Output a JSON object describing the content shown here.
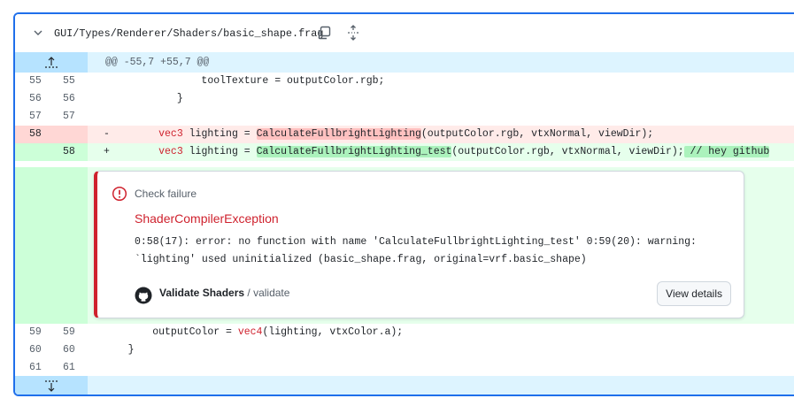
{
  "file": {
    "path": "GUI/Types/Renderer/Shaders/basic_shape.frag",
    "copy_icon": "copy-icon",
    "expand_icon": "unfold-icon"
  },
  "hunks": {
    "top": "@@ -55,7 +55,7 @@"
  },
  "lines": [
    {
      "old": "55",
      "new": "55",
      "code": "                toolTexture = outputColor.rgb;"
    },
    {
      "old": "56",
      "new": "56",
      "code": "            }"
    },
    {
      "old": "57",
      "new": "57",
      "code": ""
    }
  ],
  "deleted": {
    "old": "58",
    "sign": "-",
    "indent": "        ",
    "kw": "vec3",
    "before": " lighting = ",
    "hl": "CalculateFullbrightLighting",
    "after": "(outputColor.rgb, vtxNormal, viewDir);"
  },
  "added": {
    "new": "58",
    "sign": "+",
    "indent": "        ",
    "kw": "vec3",
    "before": " lighting = ",
    "hl": "CalculateFullbrightLighting_test",
    "mid": "(outputColor.rgb, vtxNormal, viewDir);",
    "hl2": " // hey github"
  },
  "annotation": {
    "label": "Check failure",
    "title": "ShaderCompilerException",
    "message": "0:58(17): error: no function with name 'CalculateFullbrightLighting_test' 0:59(20): warning: `lighting' used uninitialized (basic_shape.frag, original=vrf.basic_shape)",
    "workflow": "Validate Shaders",
    "separator": " / ",
    "job": "validate",
    "button": "View details",
    "danger_color": "#cf222e"
  },
  "after_lines": [
    {
      "old": "59",
      "new": "59",
      "indent": "        ",
      "pre": "outputColor = ",
      "kw": "vec4",
      "post": "(lighting, vtxColor.a);"
    },
    {
      "old": "60",
      "new": "60",
      "code": "    }"
    },
    {
      "old": "61",
      "new": "61",
      "code": ""
    }
  ]
}
